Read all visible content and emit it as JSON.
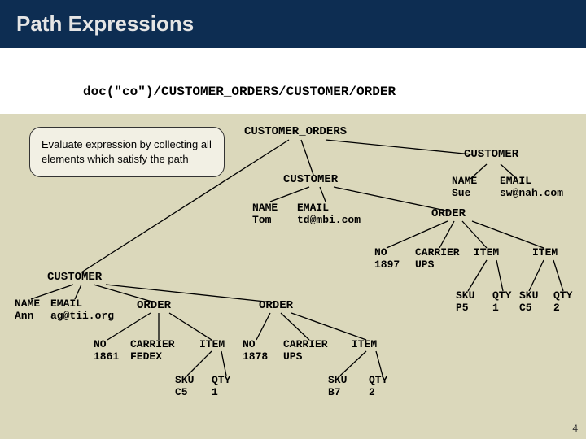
{
  "title": "Path Expressions",
  "path_expr": "doc(\"co\")/CUSTOMER_ORDERS/CUSTOMER/ORDER",
  "note": "Evaluate expression by collecting all elements which satisfy the path",
  "tree": {
    "root": "CUSTOMER_ORDERS",
    "cust_label": "CUSTOMER",
    "name_label": "NAME",
    "email_label": "EMAIL",
    "order_label": "ORDER",
    "no_label": "NO",
    "carrier_label": "CARRIER",
    "item_label": "ITEM",
    "sku_label": "SKU",
    "qty_label": "QTY",
    "sue": {
      "name": "Sue",
      "email": "sw@nah.com"
    },
    "tom": {
      "name": "Tom",
      "email": "td@mbi.com"
    },
    "ann": {
      "name": "Ann",
      "email": "ag@tii.org"
    },
    "order_1897": {
      "no": "1897",
      "carrier": "UPS",
      "item1": {
        "sku": "P5",
        "qty": "1"
      },
      "item2": {
        "sku": "C5",
        "qty": "2"
      }
    },
    "order_1861": {
      "no": "1861",
      "carrier": "FEDEX",
      "item": {
        "sku": "C5",
        "qty": "1"
      }
    },
    "order_1878": {
      "no": "1878",
      "carrier": "UPS",
      "item": {
        "sku": "B7",
        "qty": "2"
      }
    }
  },
  "page_number": "4"
}
